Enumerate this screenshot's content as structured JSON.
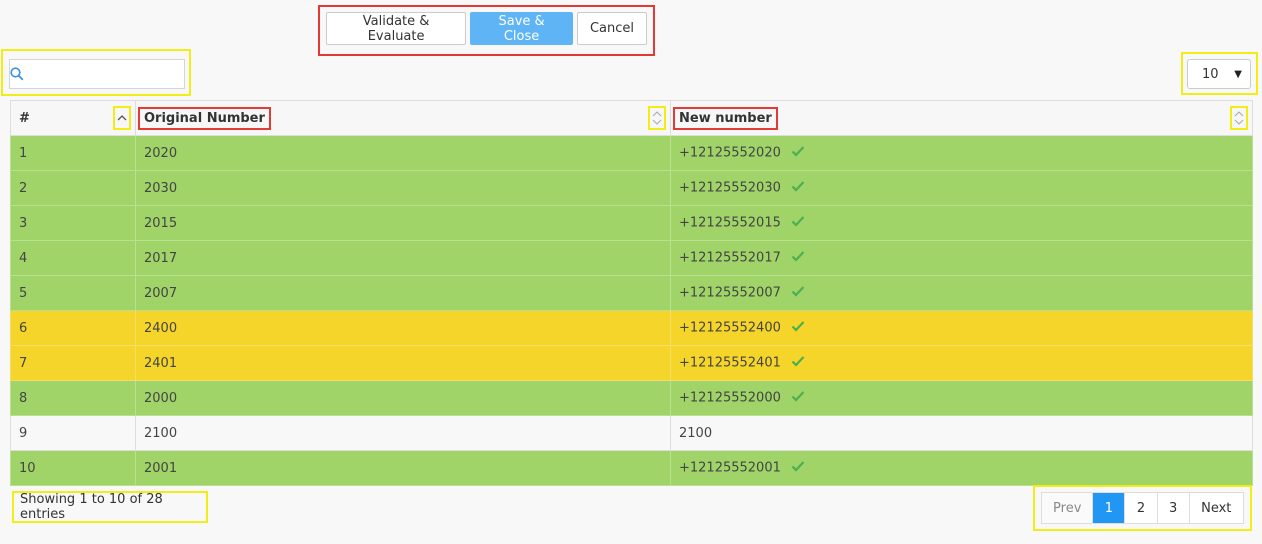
{
  "toolbar": {
    "validate_label": "Validate & Evaluate",
    "save_label": "Save & Close",
    "cancel_label": "Cancel"
  },
  "search": {
    "value": "",
    "placeholder": ""
  },
  "page_length": {
    "selected": "10"
  },
  "table": {
    "columns": [
      "#",
      "Original Number",
      "New number"
    ],
    "rows": [
      {
        "n": "1",
        "original": "2020",
        "new": "+12125552020",
        "status": "green",
        "valid": true
      },
      {
        "n": "2",
        "original": "2030",
        "new": "+12125552030",
        "status": "green",
        "valid": true
      },
      {
        "n": "3",
        "original": "2015",
        "new": "+12125552015",
        "status": "green",
        "valid": true
      },
      {
        "n": "4",
        "original": "2017",
        "new": "+12125552017",
        "status": "green",
        "valid": true
      },
      {
        "n": "5",
        "original": "2007",
        "new": "+12125552007",
        "status": "green",
        "valid": true
      },
      {
        "n": "6",
        "original": "2400",
        "new": "+12125552400",
        "status": "yellow",
        "valid": true
      },
      {
        "n": "7",
        "original": "2401",
        "new": "+12125552401",
        "status": "yellow",
        "valid": true
      },
      {
        "n": "8",
        "original": "2000",
        "new": "+12125552000",
        "status": "green",
        "valid": true
      },
      {
        "n": "9",
        "original": "2100",
        "new": "2100",
        "status": "plain",
        "valid": false
      },
      {
        "n": "10",
        "original": "2001",
        "new": "+12125552001",
        "status": "green",
        "valid": true
      }
    ]
  },
  "footer": {
    "info": "Showing 1 to 10 of 28 entries",
    "pager": {
      "prev": "Prev",
      "pages": [
        "1",
        "2",
        "3"
      ],
      "next": "Next",
      "active": "1"
    }
  },
  "colors": {
    "valid_row": "#a0d468",
    "warn_row": "#f6d52b",
    "primary": "#5fb4f5",
    "active_page": "#2196f3",
    "check": "#4caf50"
  }
}
